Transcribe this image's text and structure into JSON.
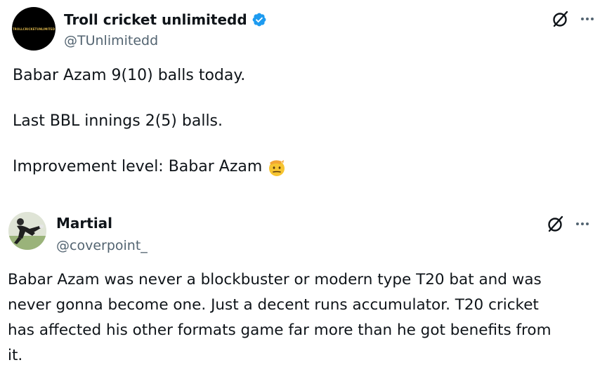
{
  "tweets": [
    {
      "author": {
        "name": "Troll cricket unlimitedd",
        "handle": "@TUnlimitedd",
        "verified": true,
        "avatar_logo_text": "TROLLCRICKETUNLIMITED"
      },
      "lines": [
        "Babar Azam 9(10) balls today.",
        "Last BBL innings 2(5) balls.",
        "Improvement level: Babar Azam"
      ],
      "emoji": "saluting-face-icon"
    },
    {
      "author": {
        "name": "Martial",
        "handle": "@coverpoint_",
        "verified": false
      },
      "lines": [
        "Babar Azam was never a blockbuster or modern type T20 bat and was",
        "never gonna become one. Just a decent runs accumulator. T20 cricket",
        "has affected his other formats game far more than he got benefits from",
        "it."
      ]
    }
  ],
  "colors": {
    "text": "#0f1419",
    "secondary": "#536471",
    "verified_badge": "#1d9bf0",
    "emoji": "#f7c531"
  },
  "icons": {
    "grok": "grok-icon",
    "more": "more-icon",
    "verified": "verified-badge-icon"
  }
}
